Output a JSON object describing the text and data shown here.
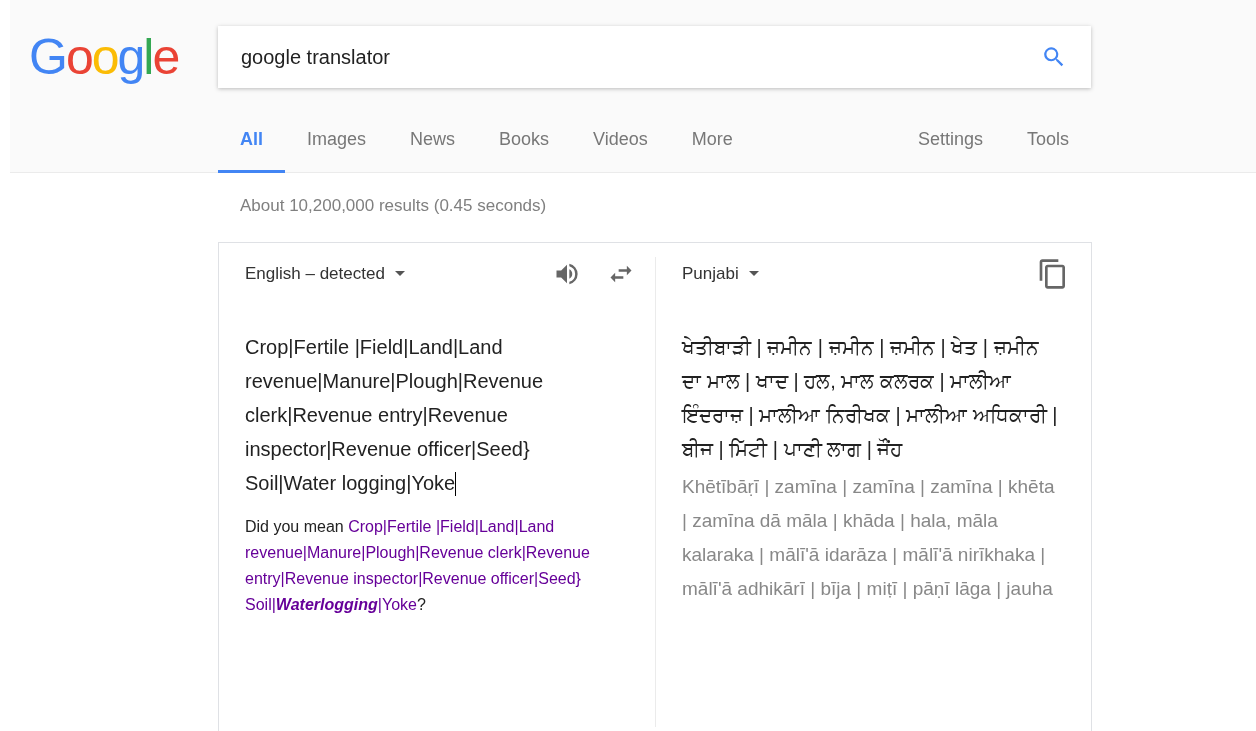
{
  "logo": "Google",
  "search": {
    "value": "google translator"
  },
  "tabs": [
    {
      "label": "All",
      "selected": true
    },
    {
      "label": "Images",
      "selected": false
    },
    {
      "label": "News",
      "selected": false
    },
    {
      "label": "Books",
      "selected": false
    },
    {
      "label": "Videos",
      "selected": false
    },
    {
      "label": "More",
      "selected": false
    }
  ],
  "tools": [
    "Settings",
    "Tools"
  ],
  "result_stats": "About 10,200,000 results (0.45 seconds)",
  "translator": {
    "source_language": "English – detected",
    "target_language": "Punjabi",
    "source_text": "Crop|Fertile |Field|Land|Land revenue|Manure|Plough|Revenue clerk|Revenue entry|Revenue inspector|Revenue officer|Seed} Soil|Water logging|Yoke",
    "did_you_mean": {
      "prefix": "Did you mean",
      "suggestion": "Crop|Fertile |Field|Land|Land revenue|Manure|Plough|Revenue clerk|Revenue entry|Revenue inspector|Revenue officer|Seed} Soil|*Waterlogging*|Yoke",
      "suffix": "?"
    },
    "translation": "ਖੇਤੀਬਾੜੀ | ਜ਼ਮੀਨ | ਜ਼ਮੀਨ | ਜ਼ਮੀਨ | ਖੇਤ | ਜ਼ਮੀਨ ਦਾ ਮਾਲ | ਖਾਦ | ਹਲ, ਮਾਲ ਕਲਰਕ | ਮਾਲੀਆ ਇੰਦਰਾਜ਼ | ਮਾਲੀਆ ਨਿਰੀਖਕ | ਮਾਲੀਆ ਅਧਿਕਾਰੀ | ਬੀਜ | ਮਿੱਟੀ | ਪਾਣੀ ਲਾਗ | ਜੌਂਹ",
    "romanization": "Khētībāṛī | zamīna | zamīna | zamīna | khēta | zamīna dā māla | khāda | hala, māla kalaraka | mālī'ā idarāza | mālī'ā nirīkhaka | mālī'ā adhikārī | bīja | miṭī | pāṇī lāga | jauha"
  }
}
